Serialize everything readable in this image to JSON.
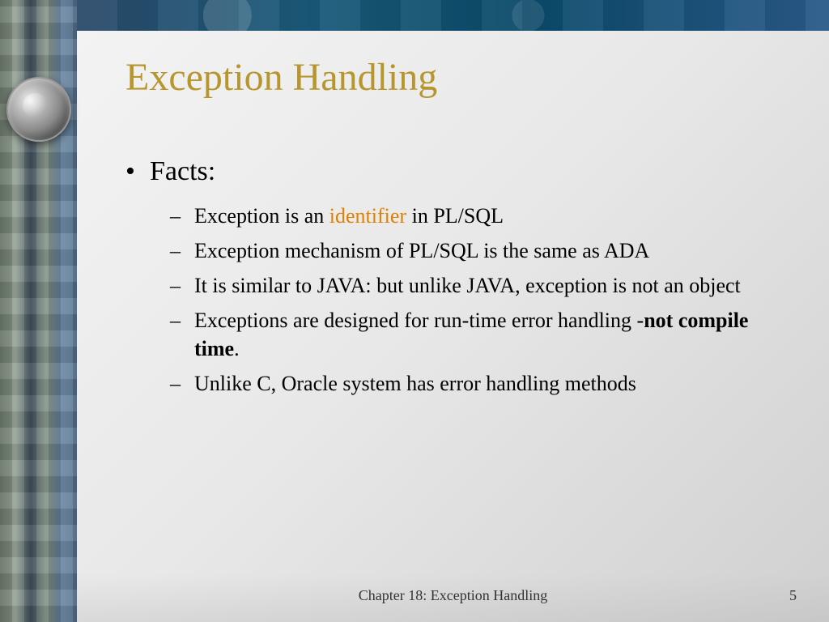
{
  "title": "Exception Handling",
  "main_item": "Facts:",
  "sub_items": {
    "s0_pre": "Exception is an ",
    "s0_hl": "identifier",
    "s0_post": " in PL/SQL",
    "s1": "Exception mechanism of PL/SQL is the same as ADA",
    "s2": "It is similar to JAVA: but unlike JAVA, exception is not an object",
    "s3_pre": "Exceptions are designed for run-time error handling -",
    "s3_bold": "not compile time",
    "s3_post": ".",
    "s4": "Unlike C, Oracle system has error handling methods"
  },
  "footer": {
    "chapter": "Chapter 18: Exception Handling",
    "page": "5"
  }
}
